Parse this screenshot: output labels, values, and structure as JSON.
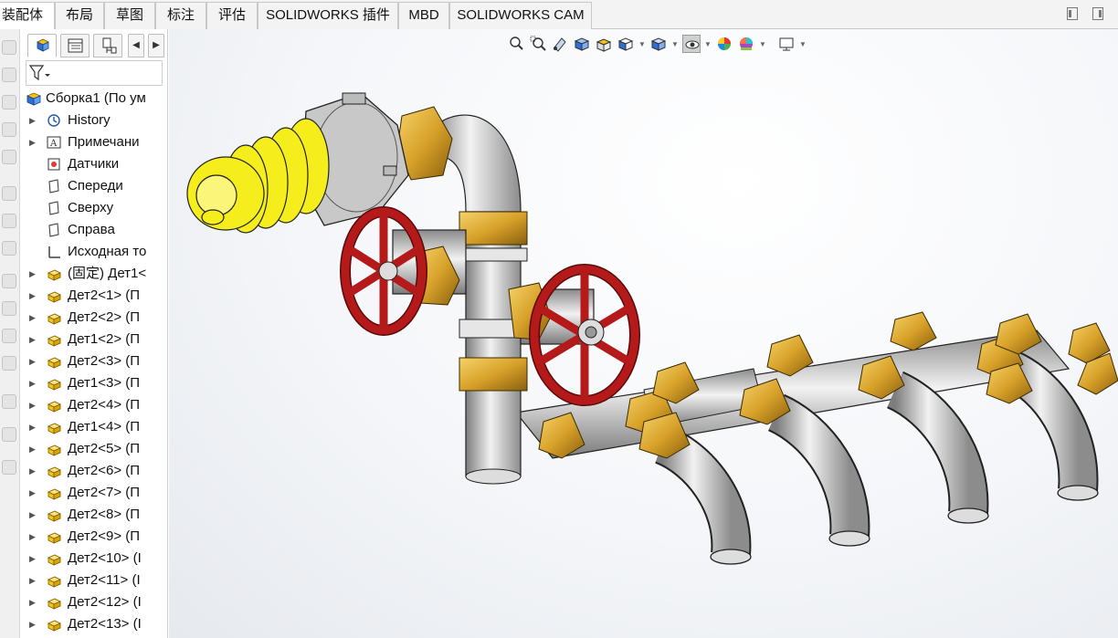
{
  "ribbon": {
    "tabs": [
      {
        "label": "装配体",
        "active": true
      },
      {
        "label": "布局"
      },
      {
        "label": "草图"
      },
      {
        "label": "标注"
      },
      {
        "label": "评估"
      },
      {
        "label": "SOLIDWORKS 插件"
      },
      {
        "label": "MBD"
      },
      {
        "label": "SOLIDWORKS CAM"
      }
    ]
  },
  "feature_manager": {
    "tabs": [
      "feature-manager-tree-icon",
      "property-manager-icon",
      "configuration-manager-icon"
    ],
    "filter_icon": "filter-icon",
    "root": "Сборка1 (По ум",
    "items": [
      {
        "label": "History",
        "icon": "history-icon",
        "expand": true
      },
      {
        "label": "Примечани",
        "icon": "annotations-icon",
        "expand": true
      },
      {
        "label": "Датчики",
        "icon": "sensors-icon",
        "expand": false
      },
      {
        "label": "Спереди",
        "icon": "plane-icon",
        "expand": false
      },
      {
        "label": "Сверху",
        "icon": "plane-icon",
        "expand": false
      },
      {
        "label": "Справа",
        "icon": "plane-icon",
        "expand": false
      },
      {
        "label": "Исходная то",
        "icon": "origin-icon",
        "expand": false
      },
      {
        "label": "(固定) Дет1<",
        "icon": "part-icon",
        "expand": true
      },
      {
        "label": "Дет2<1> (П",
        "icon": "part-icon",
        "expand": true
      },
      {
        "label": "Дет2<2> (П",
        "icon": "part-icon",
        "expand": true
      },
      {
        "label": "Дет1<2> (П",
        "icon": "part-icon",
        "expand": true
      },
      {
        "label": "Дет2<3> (П",
        "icon": "part-icon",
        "expand": true
      },
      {
        "label": "Дет1<3> (П",
        "icon": "part-icon",
        "expand": true
      },
      {
        "label": "Дет2<4> (П",
        "icon": "part-icon",
        "expand": true
      },
      {
        "label": "Дет1<4> (П",
        "icon": "part-icon",
        "expand": true
      },
      {
        "label": "Дет2<5> (П",
        "icon": "part-icon",
        "expand": true
      },
      {
        "label": "Дет2<6> (П",
        "icon": "part-icon",
        "expand": true
      },
      {
        "label": "Дет2<7> (П",
        "icon": "part-icon",
        "expand": true
      },
      {
        "label": "Дет2<8> (П",
        "icon": "part-icon",
        "expand": true
      },
      {
        "label": "Дет2<9> (П",
        "icon": "part-icon",
        "expand": true
      },
      {
        "label": "Дет2<10> (I",
        "icon": "part-icon",
        "expand": true
      },
      {
        "label": "Дет2<11> (I",
        "icon": "part-icon",
        "expand": true
      },
      {
        "label": "Дет2<12> (I",
        "icon": "part-icon",
        "expand": true
      },
      {
        "label": "Дет2<13> (I",
        "icon": "part-icon",
        "expand": true
      }
    ]
  },
  "heads_up_toolbar": [
    "zoom-to-fit-icon",
    "zoom-to-area-icon",
    "previous-view-icon",
    "section-view-icon",
    "dynamic-annotation-icon",
    "view-orientation-icon",
    "display-style-icon",
    "hide-show-items-icon",
    "edit-appearance-icon",
    "apply-scene-icon",
    "view-settings-icon"
  ],
  "colors": {
    "bulb": "#f5ee1c",
    "handwheel": "#b51a1a",
    "brass": "#d8a22a",
    "pipe": "#c9c9c9",
    "selected_tab": "#ffffff",
    "part_icon": "#f2c21b"
  }
}
